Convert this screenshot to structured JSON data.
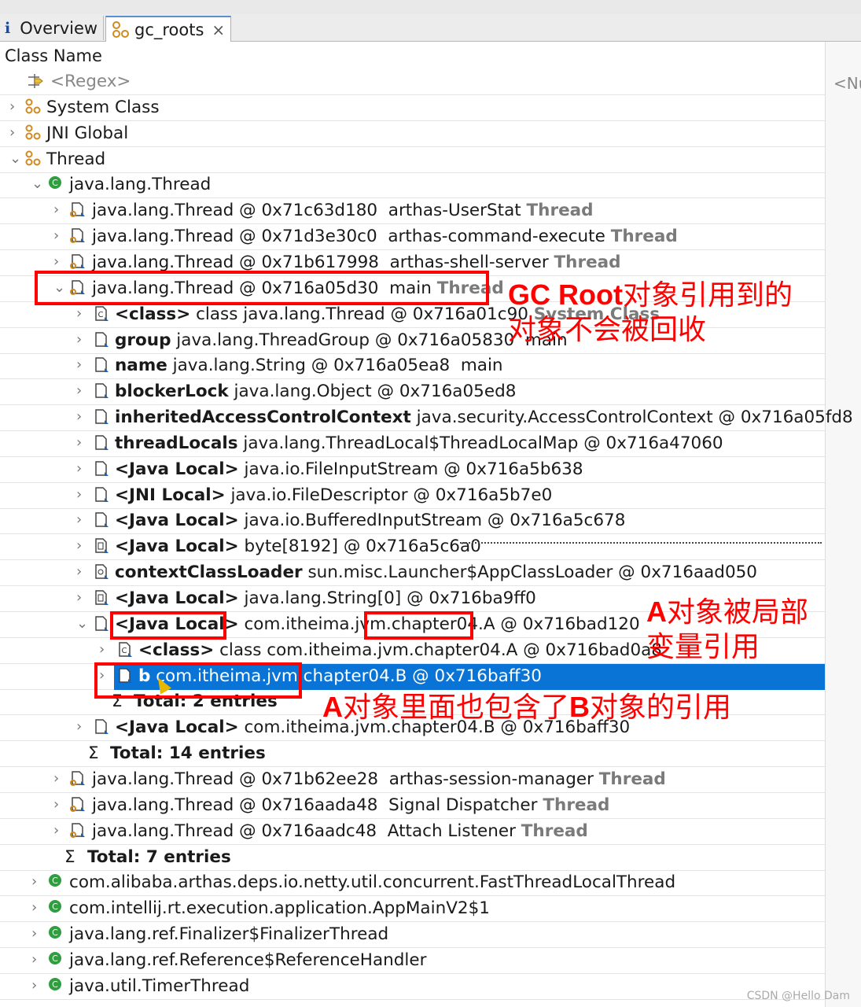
{
  "tabs": [
    {
      "label": "Overview",
      "icon": "info-icon"
    },
    {
      "label": "gc_roots",
      "icon": "gc-roots-icon",
      "closable": true
    }
  ],
  "column_header": "Class Name",
  "right_column_filter": "<Nu",
  "rows": [
    {
      "level": 0,
      "kind": "regex",
      "name": "",
      "text": "<Regex>"
    },
    {
      "level": 0,
      "kind": "group",
      "arrow": "collapsed",
      "name": "",
      "text": "System Class"
    },
    {
      "level": 0,
      "kind": "group",
      "arrow": "collapsed",
      "name": "",
      "text": "JNI Global"
    },
    {
      "level": 0,
      "kind": "group",
      "arrow": "expanded",
      "name": "",
      "text": "Thread"
    },
    {
      "level": 1,
      "kind": "class",
      "arrow": "expanded",
      "name": "",
      "text": "java.lang.Thread"
    },
    {
      "level": 2,
      "kind": "thread",
      "arrow": "collapsed",
      "name": "",
      "text": "java.lang.Thread @ 0x71c63d180  arthas-UserStat ",
      "suffix": "Thread"
    },
    {
      "level": 2,
      "kind": "thread",
      "arrow": "collapsed",
      "name": "",
      "text": "java.lang.Thread @ 0x71d3e30c0  arthas-command-execute ",
      "suffix": "Thread"
    },
    {
      "level": 2,
      "kind": "thread",
      "arrow": "collapsed",
      "name": "",
      "text": "java.lang.Thread @ 0x71b617998  arthas-shell-server ",
      "suffix": "Thread"
    },
    {
      "level": 2,
      "kind": "thread",
      "arrow": "expanded",
      "name": "",
      "text": "java.lang.Thread @ 0x716a05d30  main ",
      "suffix": "Thread"
    },
    {
      "level": 3,
      "kind": "classobj",
      "arrow": "collapsed",
      "name": "<class>",
      "text": " class java.lang.Thread @ 0x716a01c90 ",
      "suffix": "System Class"
    },
    {
      "level": 3,
      "kind": "obj",
      "arrow": "collapsed",
      "name": "group",
      "text": " java.lang.ThreadGroup @ 0x716a05830  main"
    },
    {
      "level": 3,
      "kind": "obj",
      "arrow": "collapsed",
      "name": "name",
      "text": " java.lang.String @ 0x716a05ea8  main"
    },
    {
      "level": 3,
      "kind": "obj",
      "arrow": "collapsed",
      "name": "blockerLock",
      "text": " java.lang.Object @ 0x716a05ed8"
    },
    {
      "level": 3,
      "kind": "obj",
      "arrow": "collapsed",
      "name": "inheritedAccessControlContext",
      "text": " java.security.AccessControlContext @ 0x716a05fd8"
    },
    {
      "level": 3,
      "kind": "obj",
      "arrow": "collapsed",
      "name": "threadLocals",
      "text": " java.lang.ThreadLocal$ThreadLocalMap @ 0x716a47060"
    },
    {
      "level": 3,
      "kind": "obj",
      "arrow": "collapsed",
      "name": "<Java Local>",
      "text": " java.io.FileInputStream @ 0x716a5b638"
    },
    {
      "level": 3,
      "kind": "obj",
      "arrow": "collapsed",
      "name": "<JNI Local>",
      "text": " java.io.FileDescriptor @ 0x716a5b7e0"
    },
    {
      "level": 3,
      "kind": "obj",
      "arrow": "collapsed",
      "name": "<Java Local>",
      "text": " java.io.BufferedInputStream @ 0x716a5c678"
    },
    {
      "level": 3,
      "kind": "array",
      "arrow": "collapsed",
      "name": "<Java Local>",
      "text": " byte[8192] @ 0x716a5c6a0",
      "dotted": true
    },
    {
      "level": 3,
      "kind": "classloader",
      "arrow": "collapsed",
      "name": "contextClassLoader",
      "text": " sun.misc.Launcher$AppClassLoader @ 0x716aad050"
    },
    {
      "level": 3,
      "kind": "array",
      "arrow": "collapsed",
      "name": "<Java Local>",
      "text": " java.lang.String[0] @ 0x716ba9ff0"
    },
    {
      "level": 3,
      "kind": "obj",
      "arrow": "expanded",
      "name": "<Java Local>",
      "text": " com.itheima.jvm.chapter04.A @ 0x716bad120"
    },
    {
      "level": 4,
      "kind": "classobj",
      "arrow": "collapsed",
      "name": "<class>",
      "text": " class com.itheima.jvm.chapter04.A @ 0x716bad0a8"
    },
    {
      "level": 4,
      "kind": "obj",
      "arrow": "collapsed",
      "name": "b",
      "text": " com.itheima.jvm.chapter04.B @ 0x716baff30",
      "selected": true
    },
    {
      "level": 4,
      "kind": "total",
      "name": "Total: 2 entries",
      "text": ""
    },
    {
      "level": 3,
      "kind": "obj",
      "arrow": "collapsed",
      "name": "<Java Local>",
      "text": " com.itheima.jvm.chapter04.B @ 0x716baff30"
    },
    {
      "level": 3,
      "kind": "total",
      "name": "Total: 14 entries",
      "text": ""
    },
    {
      "level": 2,
      "kind": "thread",
      "arrow": "collapsed",
      "name": "",
      "text": "java.lang.Thread @ 0x71b62ee28  arthas-session-manager ",
      "suffix": "Thread"
    },
    {
      "level": 2,
      "kind": "thread",
      "arrow": "collapsed",
      "name": "",
      "text": "java.lang.Thread @ 0x716aada48  Signal Dispatcher ",
      "suffix": "Thread"
    },
    {
      "level": 2,
      "kind": "thread",
      "arrow": "collapsed",
      "name": "",
      "text": "java.lang.Thread @ 0x716aadc48  Attach Listener ",
      "suffix": "Thread"
    },
    {
      "level": 2,
      "kind": "total",
      "name": "Total: 7 entries",
      "text": ""
    },
    {
      "level": 1,
      "kind": "class",
      "arrow": "collapsed",
      "name": "",
      "text": "com.alibaba.arthas.deps.io.netty.util.concurrent.FastThreadLocalThread"
    },
    {
      "level": 1,
      "kind": "class",
      "arrow": "collapsed",
      "name": "",
      "text": "com.intellij.rt.execution.application.AppMainV2$1"
    },
    {
      "level": 1,
      "kind": "class",
      "arrow": "collapsed",
      "name": "",
      "text": "java.lang.ref.Finalizer$FinalizerThread"
    },
    {
      "level": 1,
      "kind": "class",
      "arrow": "collapsed",
      "name": "",
      "text": "java.lang.ref.Reference$ReferenceHandler"
    },
    {
      "level": 1,
      "kind": "class",
      "arrow": "collapsed",
      "name": "",
      "text": "java.util.TimerThread"
    }
  ],
  "annotations": {
    "gc_root_bold": "GC Root",
    "gc_root_rest": "对象引用到的",
    "gc_root_line2": "对象不会被回收",
    "a_local_bold": "A",
    "a_local_rest": "对象被局部",
    "a_local_line2": "变量引用",
    "a_contains_bold1": "A",
    "a_contains_mid": "对象里面也包含了",
    "a_contains_bold2": "B",
    "a_contains_rest": "对象的引用",
    "color": "#ff0000"
  },
  "watermark": "CSDN @Hello Dam",
  "colors": {
    "selection": "#0a74d6",
    "group_icon": "#d08a1e",
    "class_icon": "#2e9e3e"
  }
}
